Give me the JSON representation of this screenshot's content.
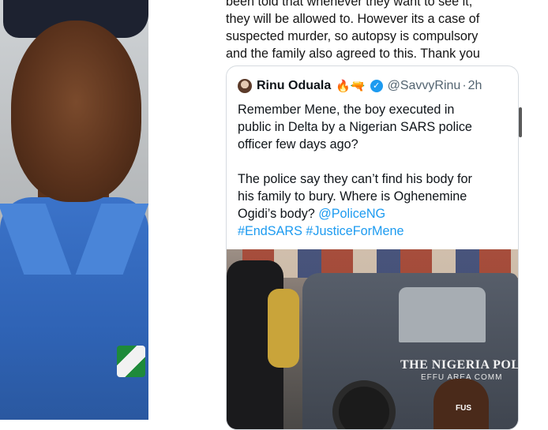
{
  "reply_text": {
    "lines": [
      "been told that whenever they want to see it,",
      "they will be allowed to. However its a case of",
      "suspected murder, so autopsy is compulsory",
      "and the family also agreed to this. Thank you"
    ]
  },
  "quoted_tweet": {
    "author_name": "Rinu Oduala",
    "author_emojis": "🔥🔫",
    "verified_icon": "verified-badge-icon",
    "handle": "@SavvyRinu",
    "separator": "·",
    "time": "2h",
    "body_lines_1": [
      "Remember Mene, the boy executed in",
      "public in Delta by a Nigerian SARS police",
      "officer few days ago?"
    ],
    "body_lines_2": [
      "The police say they can’t find his body for",
      "his family to bury. Where is Oghenemine",
      "Ogidi’s body?"
    ],
    "mention": "@PoliceNG",
    "hashtag_1": "#EndSARS",
    "hashtag_2": "#JusticeForMene",
    "photo_text_1": "THE NIGERIA POL",
    "photo_text_2": "EFFU  AREA COMM",
    "photo_shirt_text": "FUS"
  },
  "colors": {
    "link": "#1d9bf0",
    "text": "#0f1419",
    "muted": "#536471",
    "uniform": "#3b73c9"
  }
}
